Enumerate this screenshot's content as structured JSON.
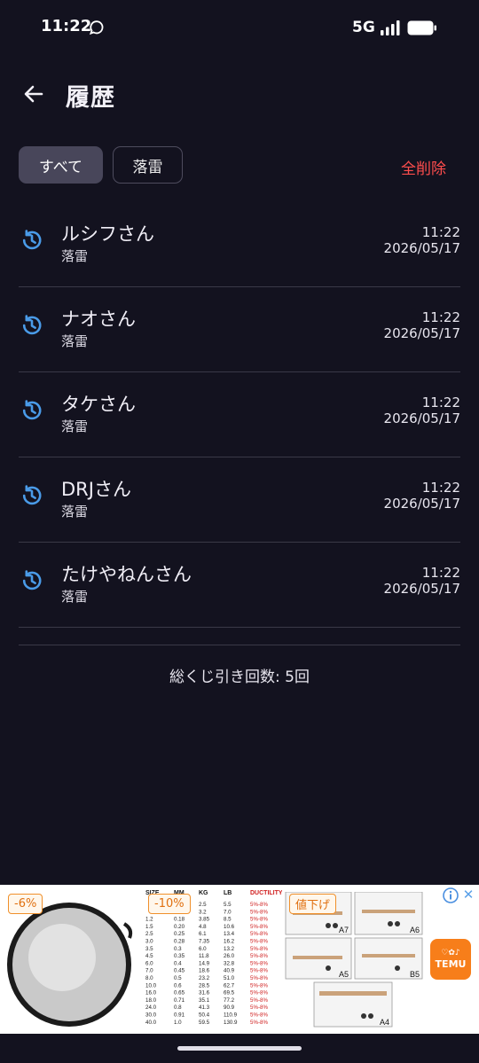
{
  "status_bar": {
    "time": "11:22",
    "network": "5G",
    "icons": [
      "chat-icon",
      "signal-icon",
      "battery-icon"
    ]
  },
  "app_bar": {
    "title": "履歴",
    "back_icon": "arrow-left-icon"
  },
  "filters": {
    "all_label": "すべて",
    "rakurai_label": "落雷",
    "selected": "すべて",
    "clear_all_label": "全削除"
  },
  "history": [
    {
      "name": "ルシフさん",
      "type": "落雷",
      "time": "11:22",
      "date": "2026/05/17"
    },
    {
      "name": "ナオさん",
      "type": "落雷",
      "time": "11:22",
      "date": "2026/05/17"
    },
    {
      "name": "タケさん",
      "type": "落雷",
      "time": "11:22",
      "date": "2026/05/17"
    },
    {
      "name": "DRJさん",
      "type": "落雷",
      "time": "11:22",
      "date": "2026/05/17"
    },
    {
      "name": "たけやねんさん",
      "type": "落雷",
      "time": "11:22",
      "date": "2026/05/17"
    }
  ],
  "summary": {
    "total_label": "総くじ引き回数: 5回"
  },
  "ad": {
    "badges": [
      "-6%",
      "-10%",
      "値下げ"
    ],
    "brand": "TEMU",
    "brand_symbols": "♡✿♪",
    "table": {
      "headers": [
        "SIZE",
        "MM",
        "KG",
        "LB",
        "DUCTILITY"
      ],
      "rows": [
        [
          "",
          "",
          "2.5",
          "5.5",
          "5%-8%"
        ],
        [
          "",
          "",
          "3.2",
          "7.0",
          "5%-8%"
        ],
        [
          "1.2",
          "0.18",
          "3.85",
          "8.5",
          "5%-8%"
        ],
        [
          "1.5",
          "0.20",
          "4.8",
          "10.6",
          "5%-8%"
        ],
        [
          "2.5",
          "0.25",
          "6.1",
          "13.4",
          "5%-8%"
        ],
        [
          "3.0",
          "0.28",
          "7.35",
          "16.2",
          "5%-8%"
        ],
        [
          "3.5",
          "0.3",
          "6.0",
          "13.2",
          "5%-8%"
        ],
        [
          "4.5",
          "0.35",
          "11.8",
          "26.0",
          "5%-8%"
        ],
        [
          "6.0",
          "0.4",
          "14.9",
          "32.8",
          "5%-8%"
        ],
        [
          "7.0",
          "0.45",
          "18.6",
          "40.9",
          "5%-8%"
        ],
        [
          "8.0",
          "0.5",
          "23.2",
          "51.0",
          "5%-8%"
        ],
        [
          "10.0",
          "0.6",
          "28.5",
          "62.7",
          "5%-8%"
        ],
        [
          "16.0",
          "0.65",
          "31.6",
          "69.5",
          "5%-8%"
        ],
        [
          "18.0",
          "0.71",
          "35.1",
          "77.2",
          "5%-8%"
        ],
        [
          "24.0",
          "0.8",
          "41.3",
          "90.9",
          "5%-8%"
        ],
        [
          "30.0",
          "0.91",
          "50.4",
          "110.9",
          "5%-8%"
        ],
        [
          "40.0",
          "1.0",
          "59.5",
          "130.9",
          "5%-8%"
        ]
      ]
    },
    "part_labels": [
      "A7",
      "A6",
      "A5",
      "B5",
      "A4"
    ]
  },
  "colors": {
    "background": "#13121f",
    "accent_blue": "#4a9be8",
    "danger": "#ff4d4d",
    "chip_selected": "#48465a",
    "temu": "#f77e1a"
  }
}
